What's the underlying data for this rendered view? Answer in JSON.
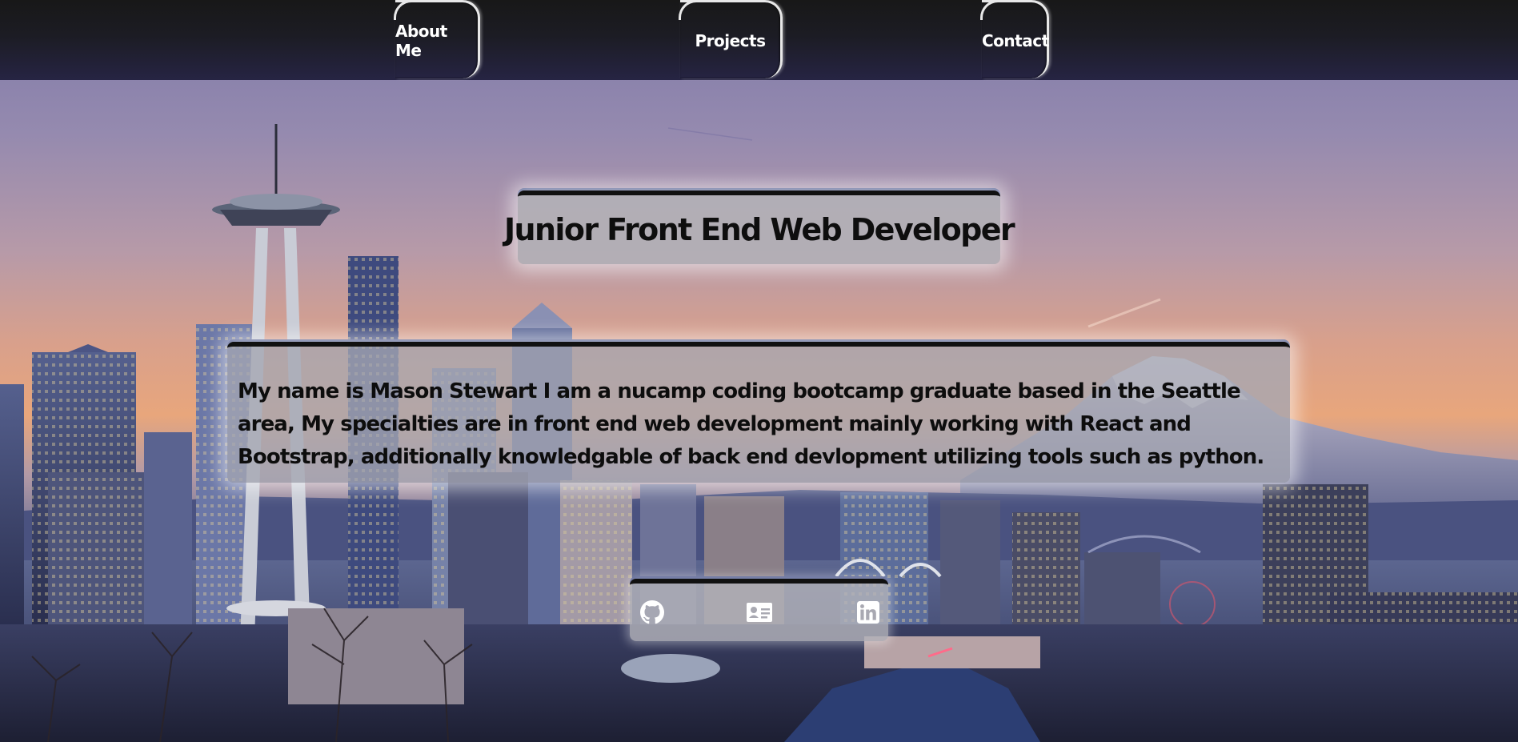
{
  "nav": {
    "about_label": "About Me",
    "projects_label": "Projects",
    "contact_label": "Contact"
  },
  "hero": {
    "title": "Junior Front End Web Developer"
  },
  "bio": {
    "text": "My name is Mason Stewart I am a nucamp coding bootcamp graduate based in the Seattle area, My specialties are in front end web development mainly working with React and Bootstrap, additionally knowledgable of back end devlopment utilizing tools such as python."
  },
  "social": {
    "icons": [
      "github-icon",
      "contact-card-icon",
      "linkedin-icon"
    ]
  },
  "colors": {
    "nav_bg": "#1a1a1a",
    "card_bg": "#b2b0b6",
    "card_border": "#111111",
    "text": "#0e0e0e",
    "nav_text": "#ffffff"
  }
}
